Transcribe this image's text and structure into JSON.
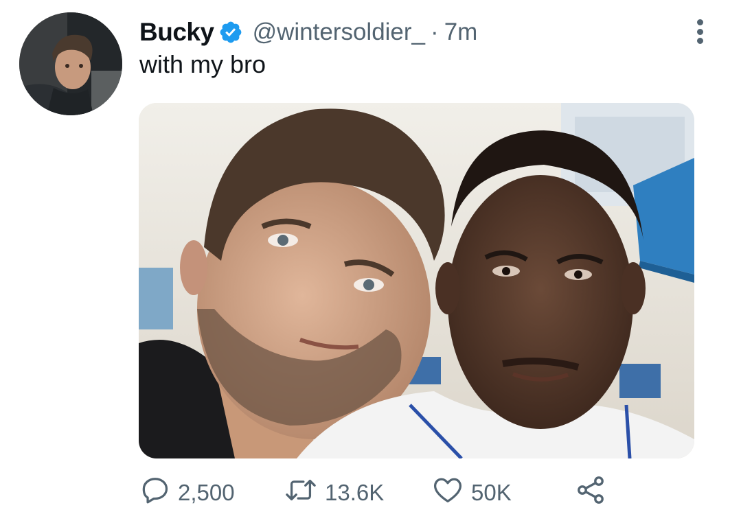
{
  "tweet": {
    "display_name": "Bucky",
    "verified": true,
    "handle": "@wintersoldier_",
    "separator": "·",
    "time": "7m",
    "text": "with my bro"
  },
  "actions": {
    "reply_count": "2,500",
    "retweet_count": "13.6K",
    "like_count": "50K"
  },
  "icons": {
    "reply": "speech-bubble-icon",
    "retweet": "retweet-arrows-icon",
    "like": "heart-icon",
    "share": "share-nodes-icon",
    "more": "vertical-dots-icon",
    "verified": "verified-badge-icon"
  },
  "colors": {
    "text_primary": "#0f1419",
    "text_secondary": "#536471",
    "verified_blue": "#1d9bf0"
  }
}
